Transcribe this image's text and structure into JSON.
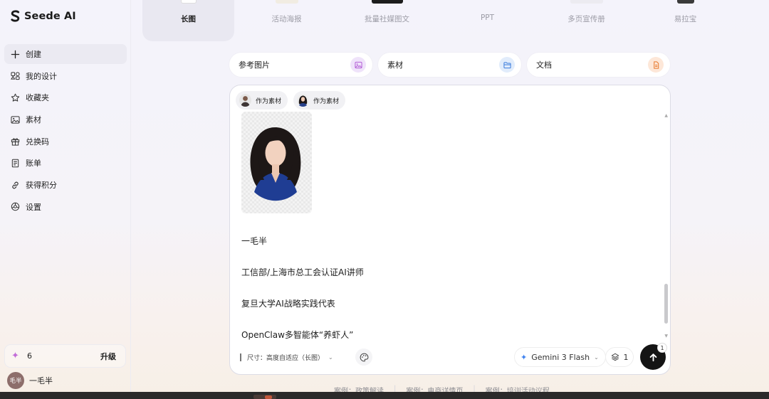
{
  "app": {
    "name": "Seede AI"
  },
  "sidebar": {
    "items": [
      {
        "label": "创建",
        "icon": "plus-icon",
        "active": true
      },
      {
        "label": "我的设计",
        "icon": "designs-icon"
      },
      {
        "label": "收藏夹",
        "icon": "star-icon"
      },
      {
        "label": "素材",
        "icon": "image-icon"
      },
      {
        "label": "兑换码",
        "icon": "gift-icon"
      },
      {
        "label": "账单",
        "icon": "receipt-icon"
      },
      {
        "label": "获得积分",
        "icon": "link-icon"
      },
      {
        "label": "设置",
        "icon": "settings-icon"
      }
    ],
    "credits": {
      "count": "6",
      "upgrade_label": "升级"
    },
    "user": {
      "avatar_text": "毛半",
      "name": "一毛半"
    }
  },
  "tabs": [
    {
      "label": "长图",
      "active": true
    },
    {
      "label": "活动海报"
    },
    {
      "label": "批量社媒图文"
    },
    {
      "label": "PPT"
    },
    {
      "label": "多页宣传册"
    },
    {
      "label": "易拉宝"
    }
  ],
  "uploads": [
    {
      "label": "参考图片",
      "icon": "image-icon",
      "color": "#efe3fa"
    },
    {
      "label": "素材",
      "icon": "folder-icon",
      "color": "#e1ecfb"
    },
    {
      "label": "文档",
      "icon": "document-icon",
      "color": "#fde7d8"
    }
  ],
  "composer": {
    "chips": [
      {
        "label": "作为素材"
      },
      {
        "label": "作为素材"
      }
    ],
    "lines": [
      "一毛半",
      "工信部/上海市总工会认证AI讲师",
      "复旦大学AI战略实践代表",
      "OpenClaw多智能体“养虾人”"
    ],
    "size_label": "尺寸：高度自适应（长图）",
    "model": "Gemini 3 Flash",
    "layer_count": "1",
    "send_badge": "1"
  },
  "cases": [
    "案例：政策解读",
    "案例：电商详情页",
    "案例：培训活动议程"
  ],
  "colors": {
    "accent": "#141414",
    "sidebar_active": "#ebeaf2"
  }
}
